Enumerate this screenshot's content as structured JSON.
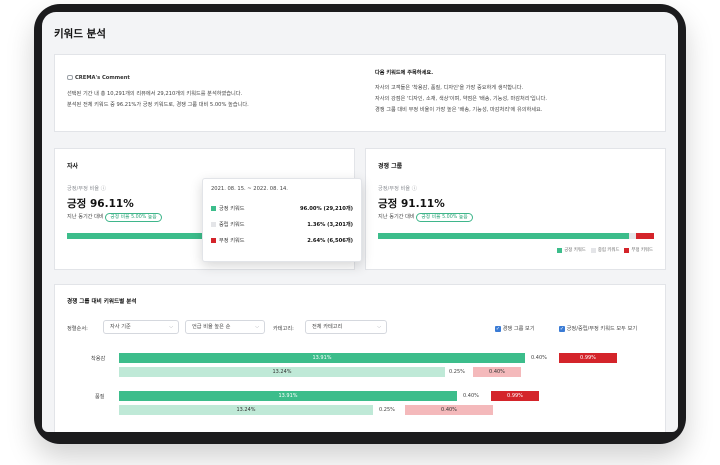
{
  "page_title": "키워드 분석",
  "comment": {
    "icon": "speech-bubble-icon",
    "heading": "CREMA's Comment",
    "lines": [
      "선택된 기간 내 총 10,291개의 리뷰에서 29,210개의 키워드를 분석하였습니다.",
      "분석된 전체 키워드 중 96.21%가 긍정 키워드로, 경쟁 그룹 대비 5.00% 높습니다."
    ]
  },
  "focus": {
    "heading": "다음 키워드에 주목하세요.",
    "lines": [
      "자사의 고객들은 '착용감, 품질, 디자인'을 가장 중요하게 생각합니다.",
      "자사의 강점은 '디자인, 소재, 색상'이며, 약점은 '배송, 기능성, 마감처리'입니다.",
      "경쟁 그룹 대비 부정 비율이 가장 높은 '배송, 기능성, 마감처리'에 유의하세요."
    ]
  },
  "own_card": {
    "title": "자사",
    "metric_label": "긍정/부정 비율",
    "big_value": "긍정 96.11%",
    "compare_label": "지난 동기간 대비",
    "pill": "긍정 비율 5.00% 높음",
    "bar": {
      "positive": 96.0,
      "neutral": 1.36,
      "negative": 2.64
    }
  },
  "comp_card": {
    "title": "경쟁 그룹",
    "metric_label": "긍정/부정 비율",
    "big_value": "긍정 91.11%",
    "compare_label": "지난 동기간 대비",
    "pill": "긍정 비율 5.00% 높음",
    "bar": {
      "positive": 91.11,
      "neutral": 2.5,
      "negative": 6.39
    }
  },
  "legend": {
    "positive": "긍정 키워드",
    "neutral": "중립 키워드",
    "negative": "부정 키워드"
  },
  "colors": {
    "positive": "#3cbd8b",
    "positive_light": "#bfe9d7",
    "neutral": "#e4e5e8",
    "negative": "#d4242a",
    "negative_light": "#f4b9bb",
    "accent": "#3a7bd5"
  },
  "tooltip": {
    "period": "2021. 08. 15. ~ 2022. 08. 14.",
    "rows": [
      {
        "label": "긍정 키워드",
        "value": "96.00% (29,210개)",
        "color": "#3cbd8b"
      },
      {
        "label": "중립 키워드",
        "value": "1.36% (3,201개)",
        "color": "#e4e5e8"
      },
      {
        "label": "부정 키워드",
        "value": "2.64% (6,506개)",
        "color": "#d4242a"
      }
    ]
  },
  "analysis": {
    "title": "경쟁 그룹 대비 키워드별 분석",
    "sort_label": "정렬순서:",
    "sort1": "자사 기준",
    "sort2": "언급 비율 높은 순",
    "cat_label": "카테고리:",
    "cat_value": "전체 카테고리",
    "check1": "경쟁 그룹 보기",
    "check2": "긍정/중립/부정 키워드 모두 보기",
    "rows": [
      {
        "name": "착용감",
        "own": {
          "pos": "13.91%",
          "neu": "0.40%",
          "neg": "0.99%"
        },
        "comp": {
          "pos": "13.24%",
          "neu": "0.25%",
          "neg": "0.40%"
        }
      },
      {
        "name": "품질",
        "own": {
          "pos": "13.91%",
          "neu": "0.40%",
          "neg": "0.99%"
        },
        "comp": {
          "pos": "13.24%",
          "neu": "0.25%",
          "neg": "0.40%"
        }
      }
    ]
  }
}
